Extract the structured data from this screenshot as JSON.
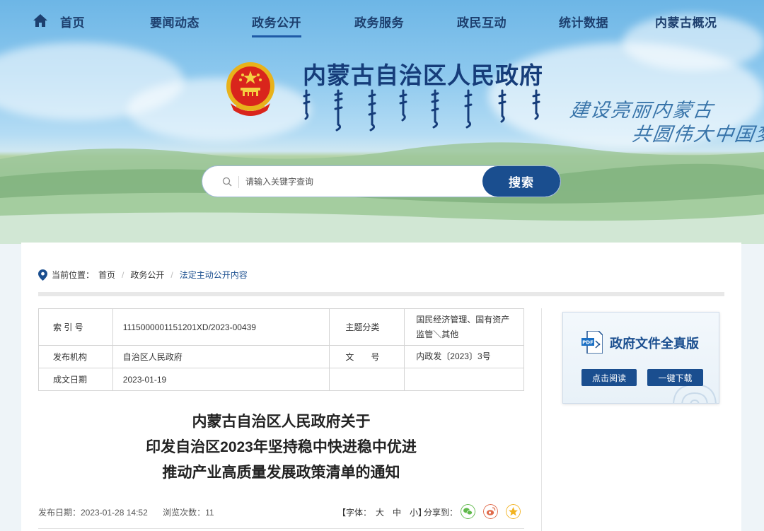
{
  "nav": {
    "items": [
      {
        "label": "首页"
      },
      {
        "label": "要闻动态"
      },
      {
        "label": "政务公开",
        "active": true
      },
      {
        "label": "政务服务"
      },
      {
        "label": "政民互动"
      },
      {
        "label": "统计数据"
      },
      {
        "label": "内蒙古概况"
      }
    ]
  },
  "header": {
    "title": "内蒙古自治区人民政府",
    "slogan_line1": "建设亮丽内蒙古",
    "slogan_line2": "共圆伟大中国梦"
  },
  "search": {
    "placeholder": "请输入关键字查询",
    "button_label": "搜索"
  },
  "breadcrumb": {
    "prefix": "当前位置：",
    "items": [
      "首页",
      "政务公开",
      "法定主动公开内容"
    ]
  },
  "info_table": {
    "rows": [
      {
        "label1": "索 引 号",
        "value1": "1115000001151201XD/2023-00439",
        "label2": "主题分类",
        "value2": "国民经济管理、国有资产监管＼其他"
      },
      {
        "label1": "发布机构",
        "value1": "自治区人民政府",
        "label2": "文　　号",
        "value2": "内政发〔2023〕3号"
      },
      {
        "label1": "成文日期",
        "value1": "2023-01-19",
        "label2": "",
        "value2": ""
      }
    ]
  },
  "side_box": {
    "title": "政府文件全真版",
    "read_label": "点击阅读",
    "download_label": "一键下载"
  },
  "document": {
    "title_lines": [
      "内蒙古自治区人民政府关于",
      "印发自治区2023年坚持稳中快进稳中优进",
      "推动产业高质量发展政策清单的通知"
    ],
    "publish_date": "发布日期：2023-01-28 14:52",
    "views": "浏览次数：11",
    "font_label": "【字体：",
    "font_large": "大",
    "font_medium": "中",
    "font_small": "小】",
    "share_label": "分享到："
  },
  "colors": {
    "primary": "#1a4e8f",
    "nav_text": "#1d3f6e",
    "wechat": "#5fb94a",
    "weibo": "#e06a4a",
    "qzone": "#f2b321"
  }
}
